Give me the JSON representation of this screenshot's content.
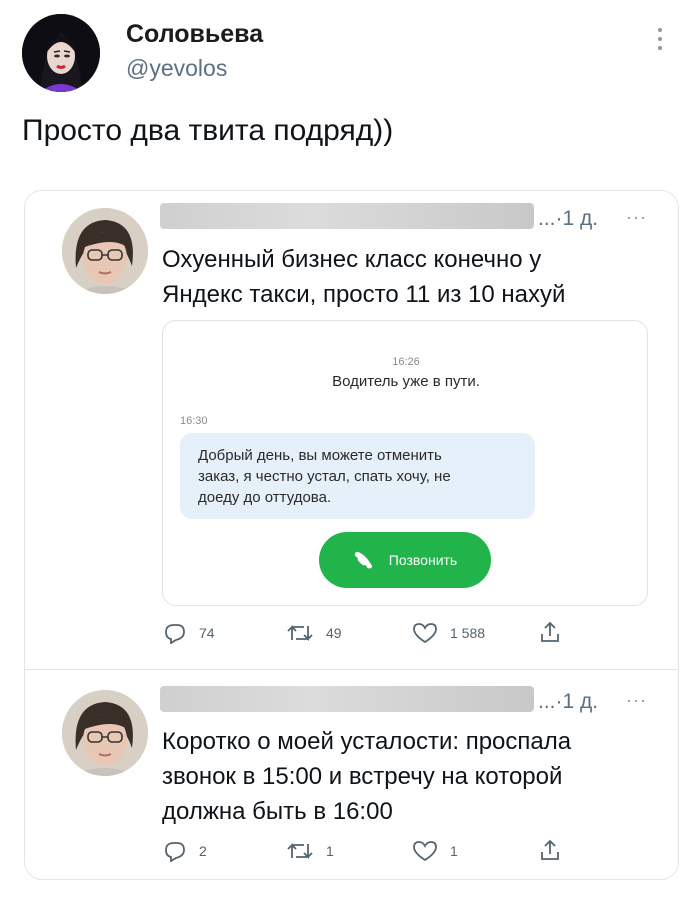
{
  "author": {
    "name": "Соловьева",
    "handle": "@yevolos"
  },
  "tweet": {
    "text": "Просто два твита подряд))"
  },
  "quoted": [
    {
      "time": "1 д.",
      "text_line1": "Охуенный бизнес класс конечно у",
      "text_line2": "Яндекс такси, просто 11 из 10 нахуй",
      "media": {
        "time1": "16:26",
        "status": "Водитель уже в пути.",
        "time2": "16:30",
        "message_line1": "Добрый день, вы можете отменить",
        "message_line2": "заказ, я честно устал, спать хочу, не",
        "message_line3": "доеду до оттудова.",
        "call_label": "Позвонить",
        "call_color": "#21b44b"
      },
      "replies": "74",
      "retweets": "49",
      "likes": "1 588"
    },
    {
      "time": "1 д.",
      "text_line1": "Коротко о моей усталости: проспала",
      "text_line2": "звонок в 15:00 и встречу на которой",
      "text_line3": "должна быть в 16:00",
      "replies": "2",
      "retweets": "1",
      "likes": "1"
    }
  ]
}
